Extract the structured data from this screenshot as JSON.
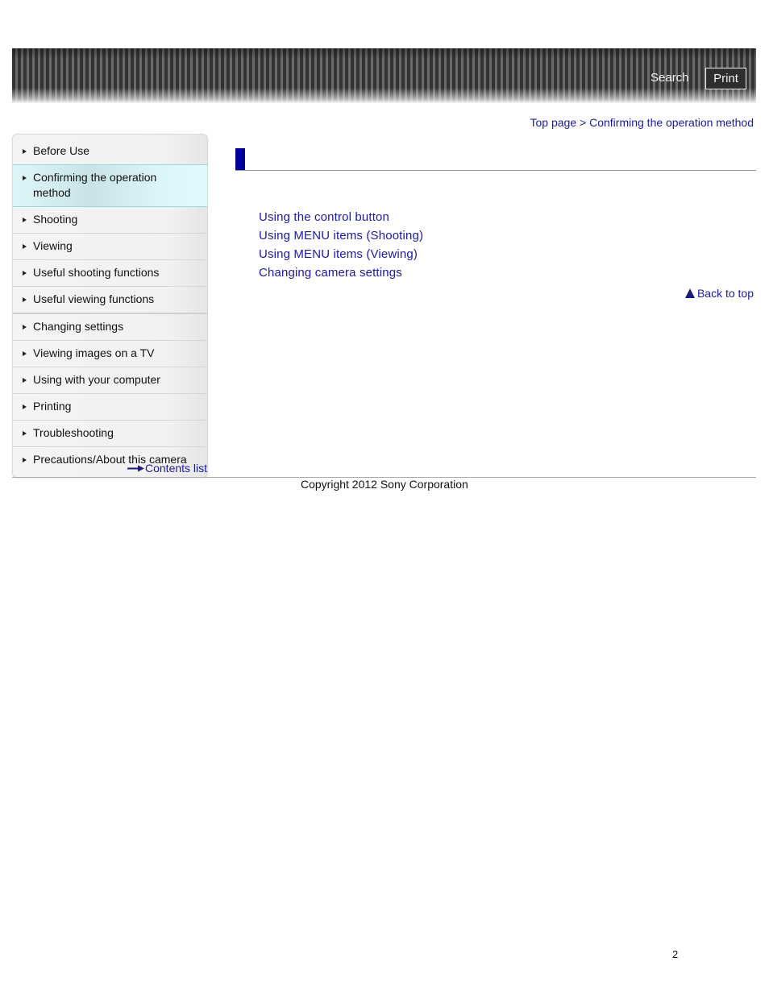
{
  "header": {
    "search_label": "Search",
    "print_label": "Print"
  },
  "breadcrumb": {
    "top_page": "Top page",
    "separator": " > ",
    "current": "Confirming the operation method"
  },
  "sidebar": {
    "items": [
      {
        "label": "Before Use",
        "active": false
      },
      {
        "label": "Confirming the operation method",
        "active": true
      },
      {
        "label": "Shooting",
        "active": false
      },
      {
        "label": "Viewing",
        "active": false
      },
      {
        "label": "Useful shooting functions",
        "active": false
      },
      {
        "label": "Useful viewing functions",
        "active": false
      },
      {
        "label": "Changing settings",
        "active": false
      },
      {
        "label": "Viewing images on a TV",
        "active": false
      },
      {
        "label": "Using with your computer",
        "active": false
      },
      {
        "label": "Printing",
        "active": false
      },
      {
        "label": "Troubleshooting",
        "active": false
      },
      {
        "label": "Precautions/About this camera",
        "active": false
      }
    ],
    "contents_list_label": "Contents list"
  },
  "main": {
    "links": [
      "Using the control button",
      "Using MENU items (Shooting)",
      "Using MENU items (Viewing)",
      "Changing camera settings"
    ],
    "back_to_top_label": "Back to top"
  },
  "footer": {
    "copyright": "Copyright 2012 Sony Corporation",
    "page_number": "2"
  },
  "colors": {
    "link": "#1a1aa6",
    "title_bar": "#000099",
    "active_nav_border": "#8fdbe8"
  }
}
